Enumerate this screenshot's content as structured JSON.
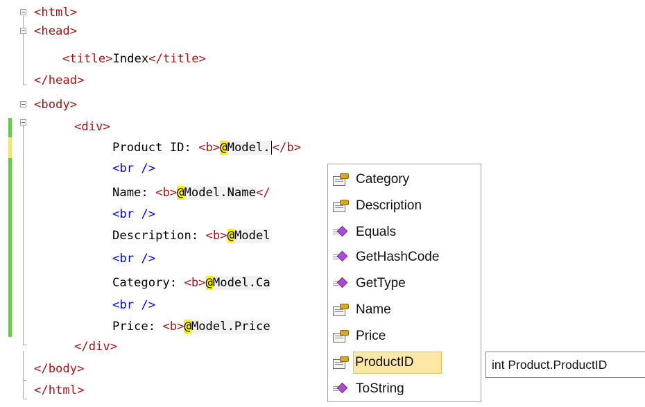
{
  "colors": {
    "tag": "#a31515",
    "attr_blue": "#0000ff",
    "razor_at_highlight": "#ffef00",
    "change_green": "#6cc655",
    "change_yellow": "#f5e27a",
    "selection": "#fde6a6"
  },
  "code": {
    "l1": {
      "open": "<html>"
    },
    "l2": {
      "open": "<head>"
    },
    "l3": {
      "open": "<title>",
      "text": "Index",
      "close": "</title>"
    },
    "l4": {
      "close": "</head>"
    },
    "l5": {
      "open": "<body>"
    },
    "l6": {
      "open": "<div>"
    },
    "l7": {
      "label": "Product ID: ",
      "b_open": "<b>",
      "at": "@",
      "expr": "Model.",
      "b_close": "</b>"
    },
    "l8": {
      "br": "<br />"
    },
    "l9": {
      "label": "Name: ",
      "b_open": "<b>",
      "at": "@",
      "expr": "Model.Name",
      "b_close": "</"
    },
    "l10": {
      "br": "<br />"
    },
    "l11": {
      "label": "Description: ",
      "b_open": "<b>",
      "at": "@",
      "expr": "Model"
    },
    "l12": {
      "br": "<br />"
    },
    "l13": {
      "label": "Category: ",
      "b_open": "<b>",
      "at": "@",
      "expr": "Model.Ca"
    },
    "l14": {
      "br": "<br />"
    },
    "l15": {
      "label": "Price: ",
      "b_open": "<b>",
      "at": "@",
      "expr": "Model.Price"
    },
    "l16": {
      "close": "</div>"
    },
    "l17": {
      "close": "</body>"
    },
    "l18": {
      "close": "</html>"
    }
  },
  "intellisense": {
    "items": [
      {
        "label": "Category",
        "kind": "property-icon"
      },
      {
        "label": "Description",
        "kind": "property-icon"
      },
      {
        "label": "Equals",
        "kind": "method-icon"
      },
      {
        "label": "GetHashCode",
        "kind": "method-icon"
      },
      {
        "label": "GetType",
        "kind": "method-icon"
      },
      {
        "label": "Name",
        "kind": "property-icon"
      },
      {
        "label": "Price",
        "kind": "property-icon"
      },
      {
        "label": "ProductID",
        "kind": "property-icon",
        "selected": true
      },
      {
        "label": "ToString",
        "kind": "method-icon"
      }
    ],
    "tooltip": "int Product.ProductID"
  }
}
